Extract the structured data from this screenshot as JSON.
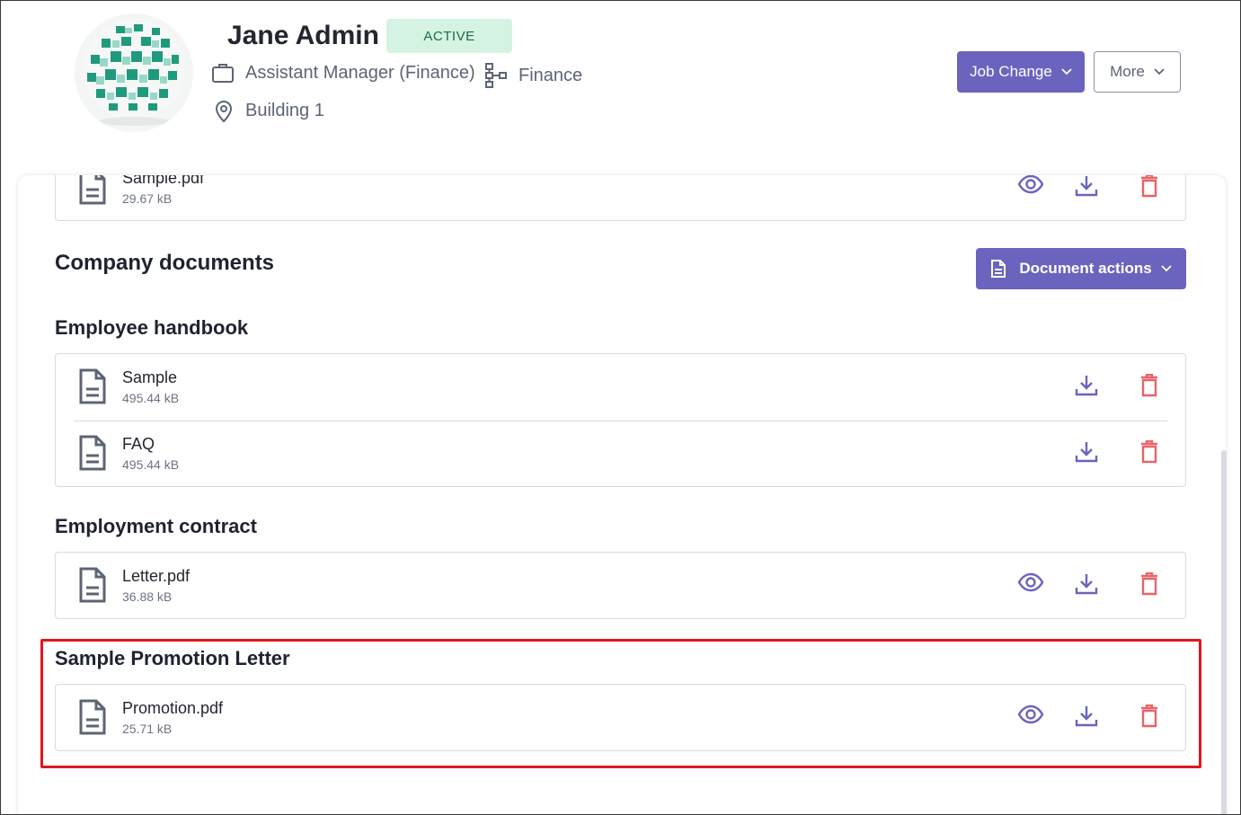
{
  "header": {
    "name": "Jane Admin",
    "status": "ACTIVE",
    "job_title": "Assistant Manager (Finance)",
    "department": "Finance",
    "location": "Building 1",
    "job_change_label": "Job Change",
    "more_label": "More"
  },
  "top_doc": {
    "name": "Sample.pdf",
    "size": "29.67 kB"
  },
  "company_documents": {
    "title": "Company documents",
    "actions_label": "Document actions"
  },
  "groups": [
    {
      "title": "Employee handbook",
      "docs": [
        {
          "name": "Sample",
          "size": "495.44 kB"
        },
        {
          "name": "FAQ",
          "size": "495.44 kB"
        }
      ]
    },
    {
      "title": "Employment contract",
      "docs": [
        {
          "name": "Letter.pdf",
          "size": "36.88 kB"
        }
      ]
    },
    {
      "title": "Sample Promotion Letter",
      "docs": [
        {
          "name": "Promotion.pdf",
          "size": "25.71 kB"
        }
      ]
    }
  ],
  "colors": {
    "accent": "#6a64be",
    "delete": "#e8646a",
    "badge_bg": "#d4f3e3",
    "highlight": "#e0161e"
  }
}
